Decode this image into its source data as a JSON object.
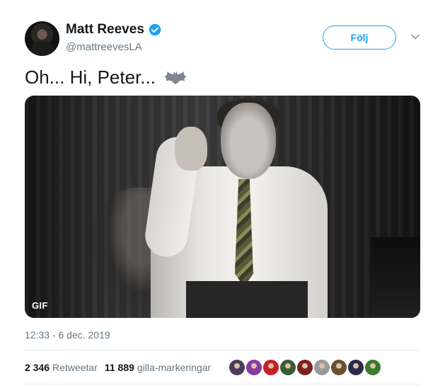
{
  "author": {
    "display_name": "Matt Reeves",
    "handle": "@mattreevesLA",
    "verified": true
  },
  "follow_label": "Följ",
  "tweet": {
    "text": "Oh... Hi, Peter...",
    "emoji": "bat-emoji"
  },
  "media": {
    "badge": "GIF"
  },
  "timestamp": "12:33 - 6 dec. 2019",
  "stats": {
    "retweets_count": "2 346",
    "retweets_label": "Retweetar",
    "likes_count": "11 889",
    "likes_label": "gilla-markeringar"
  },
  "likers": [
    {
      "color": "#4a3c5a"
    },
    {
      "color": "#8a3aa0"
    },
    {
      "color": "#c81e28"
    },
    {
      "color": "#3a5a3a"
    },
    {
      "color": "#7a2020"
    },
    {
      "color": "#9a9a9a"
    },
    {
      "color": "#6a5030"
    },
    {
      "color": "#2a2a4a"
    },
    {
      "color": "#3a7a2a"
    }
  ],
  "colors": {
    "accent": "#1da1f2",
    "text_secondary": "#657786",
    "divider": "#e6ecf0"
  }
}
